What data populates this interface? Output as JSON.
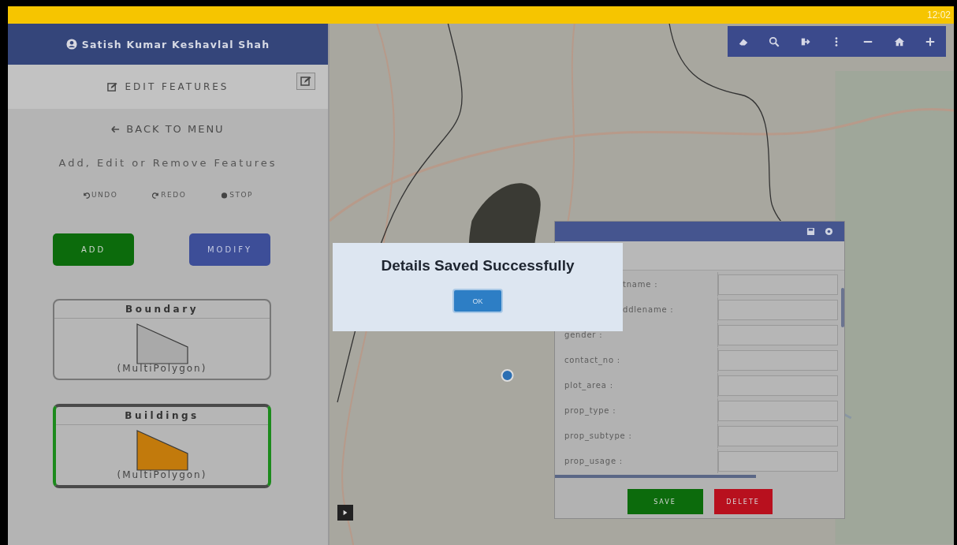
{
  "status_bar": {
    "time": "12:02"
  },
  "sidebar": {
    "user": "Satish Kumar Keshavlal Shah",
    "section_title": "EDIT FEATURES",
    "back": "BACK TO MENU",
    "subtitle": "Add, Edit or Remove Features",
    "history_actions": [
      {
        "kind": "undo",
        "label": "UNDO"
      },
      {
        "kind": "redo",
        "label": "REDO"
      },
      {
        "kind": "stop",
        "label": "STOP"
      }
    ],
    "mode_buttons": [
      {
        "kind": "add",
        "label": "ADD"
      },
      {
        "kind": "modify",
        "label": "MODIFY"
      }
    ],
    "layers": [
      {
        "name": "Boundary",
        "geometry": "(MultiPolygon)",
        "selected": false,
        "color": "#a9a9a9"
      },
      {
        "name": "Buildings",
        "geometry": "(MultiPolygon)",
        "selected": true,
        "color": "#c27a0c"
      }
    ]
  },
  "feature_form": {
    "fields": [
      {
        "label": "tname :",
        "covered": true
      },
      {
        "label": "ddlename :",
        "covered": true
      },
      {
        "label": "gender :"
      },
      {
        "label": "contact_no :"
      },
      {
        "label": "plot_area :"
      },
      {
        "label": "prop_type :"
      },
      {
        "label": "prop_subtype :"
      },
      {
        "label": "prop_usage :"
      }
    ],
    "buttons": [
      {
        "kind": "save",
        "label": "SAVE"
      },
      {
        "kind": "delete",
        "label": "DELETE"
      }
    ]
  },
  "dialog": {
    "message": "Details Saved Successfully",
    "button": "OK"
  }
}
